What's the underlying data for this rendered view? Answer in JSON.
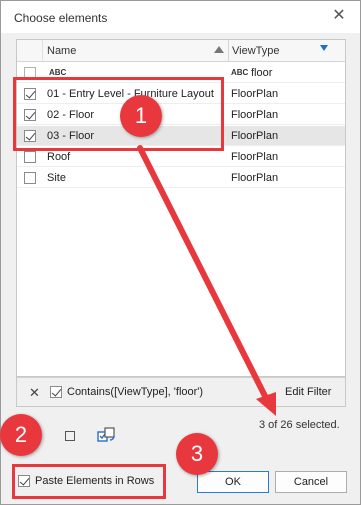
{
  "window": {
    "title": "Choose elements"
  },
  "grid": {
    "columns": [
      "Name",
      "ViewType"
    ],
    "filter_row": {
      "name_value": "",
      "viewtype_value": "floor"
    },
    "rows": [
      {
        "checked": true,
        "name": "01 - Entry Level - Furniture Layout",
        "viewtype": "FloorPlan",
        "selected": false
      },
      {
        "checked": true,
        "name": "02 - Floor",
        "viewtype": "FloorPlan",
        "selected": false
      },
      {
        "checked": true,
        "name": "03 - Floor",
        "viewtype": "FloorPlan",
        "selected": true
      },
      {
        "checked": false,
        "name": "Roof",
        "viewtype": "FloorPlan",
        "selected": false
      },
      {
        "checked": false,
        "name": "Site",
        "viewtype": "FloorPlan",
        "selected": false
      }
    ]
  },
  "filter_bar": {
    "expression": "Contains([ViewType], 'floor')",
    "edit_label": "Edit Filter"
  },
  "status": {
    "text": "3 of 26 selected."
  },
  "options": {
    "paste_label": "Paste Elements in Rows"
  },
  "buttons": {
    "ok": "OK",
    "cancel": "Cancel"
  },
  "annotations": {
    "one": "1",
    "two": "2",
    "three": "3"
  },
  "colors": {
    "annotation": "#e8383d",
    "ok_border": "#2a7bd4",
    "filter_icon": "#1a6fc9"
  }
}
